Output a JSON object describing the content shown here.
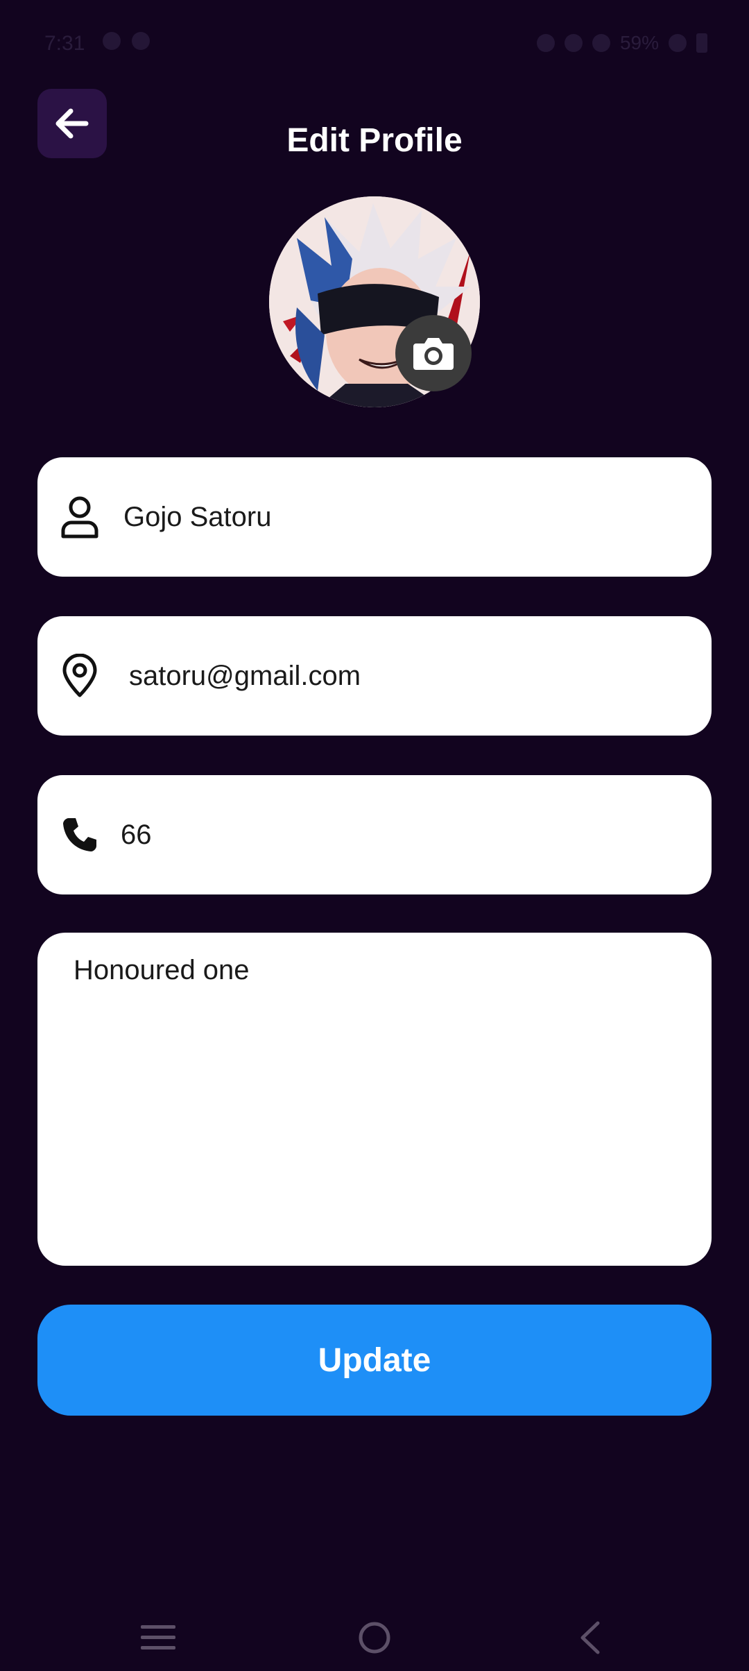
{
  "status_bar": {
    "time": "7:31",
    "battery_percent": "59%"
  },
  "header": {
    "title": "Edit Profile"
  },
  "avatar": {
    "icon": "camera-icon"
  },
  "form": {
    "name": {
      "icon": "user-icon",
      "value": "Gojo Satoru"
    },
    "email": {
      "icon": "location-pin-icon",
      "value": "satoru@gmail.com"
    },
    "phone": {
      "icon": "phone-icon",
      "value": "66"
    },
    "bio": {
      "value": "Honoured one"
    }
  },
  "actions": {
    "update_label": "Update"
  },
  "colors": {
    "background": "#12041f",
    "back_button": "#2b1245",
    "accent": "#1e8ff7",
    "field": "#ffffff"
  },
  "nav": [
    "menu-icon",
    "home-icon",
    "back-icon"
  ]
}
